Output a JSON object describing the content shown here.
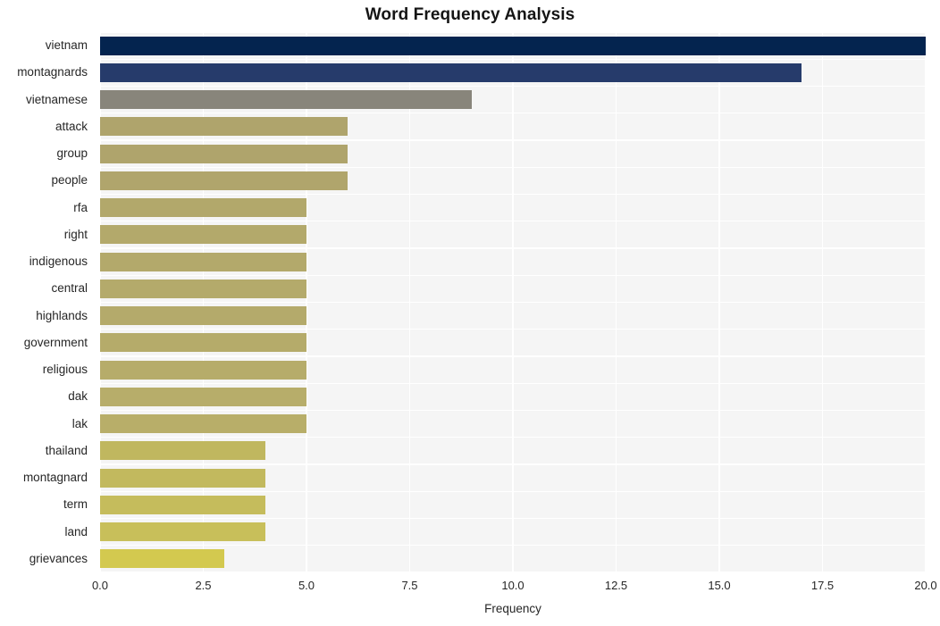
{
  "chart_data": {
    "type": "bar",
    "orientation": "horizontal",
    "title": "Word Frequency Analysis",
    "xlabel": "Frequency",
    "ylabel": "",
    "categories": [
      "vietnam",
      "montagnards",
      "vietnamese",
      "attack",
      "group",
      "people",
      "rfa",
      "right",
      "indigenous",
      "central",
      "highlands",
      "government",
      "religious",
      "dak",
      "lak",
      "thailand",
      "montagnard",
      "term",
      "land",
      "grievances"
    ],
    "values": [
      20,
      17,
      9,
      6,
      6,
      6,
      5,
      5,
      5,
      5,
      5,
      5,
      5,
      5,
      5,
      4,
      4,
      4,
      4,
      3
    ],
    "bar_colors": [
      "#04244f",
      "#263b6b",
      "#88857b",
      "#afa46c",
      "#afa46c",
      "#b0a56c",
      "#b2a86b",
      "#b3a96b",
      "#b3a96b",
      "#b4aa6b",
      "#b4aa6b",
      "#b5ab6a",
      "#b6ac6a",
      "#b7ad6a",
      "#b8ae69",
      "#c0b75f",
      "#c2b95e",
      "#c5bc5c",
      "#c8bf5a",
      "#d3c94f"
    ],
    "xlim": [
      0.0,
      20.0
    ],
    "xticks": [
      "0.0",
      "2.5",
      "5.0",
      "7.5",
      "10.0",
      "12.5",
      "15.0",
      "17.5",
      "20.0"
    ],
    "xtick_values": [
      0.0,
      2.5,
      5.0,
      7.5,
      10.0,
      12.5,
      15.0,
      17.5,
      20.0
    ],
    "grid": true,
    "grid_color": "#ffffff",
    "plot_background": "#f5f5f5",
    "figure_background": "#ffffff",
    "legend": null
  }
}
